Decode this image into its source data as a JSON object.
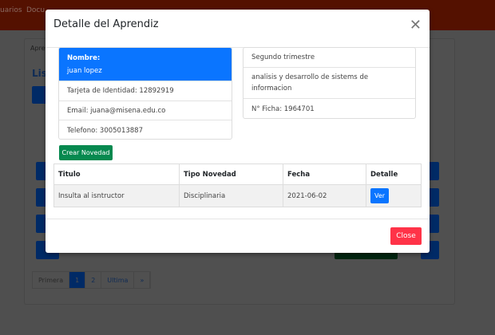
{
  "navbar": {
    "items": [
      "uarios",
      "Docu"
    ]
  },
  "background": {
    "tab": "Apre",
    "title": "List",
    "pagination": [
      "Primera",
      "1",
      "2",
      "Ultima",
      "»"
    ]
  },
  "modal": {
    "title": "Detalle del Aprendiz",
    "close_icon": "close-icon",
    "student": {
      "name_label": "Nombre:",
      "name": "juan lopez",
      "id": "Tarjeta de Identidad: 12892919",
      "email": "Email: juana@misena.edu.co",
      "phone": "Telefono: 3005013887"
    },
    "program": {
      "term": "Segundo trimestre",
      "program": "analisis y desarrollo de sistems de informacion",
      "ficha": "N° Ficha: 1964701"
    },
    "create_button": "Crear Novedad",
    "table": {
      "headers": [
        "Titulo",
        "Tipo Novedad",
        "Fecha",
        "Detalle"
      ],
      "rows": [
        {
          "titulo": "Insulta al isntructor",
          "tipo": "Disciplinaria",
          "fecha": "2021-06-02",
          "action": "Ver"
        }
      ]
    },
    "close_button": "Close"
  },
  "colors": {
    "primary": "#0a75ff",
    "success": "#06894f",
    "danger": "#ff3348",
    "navbar": "#541100"
  }
}
